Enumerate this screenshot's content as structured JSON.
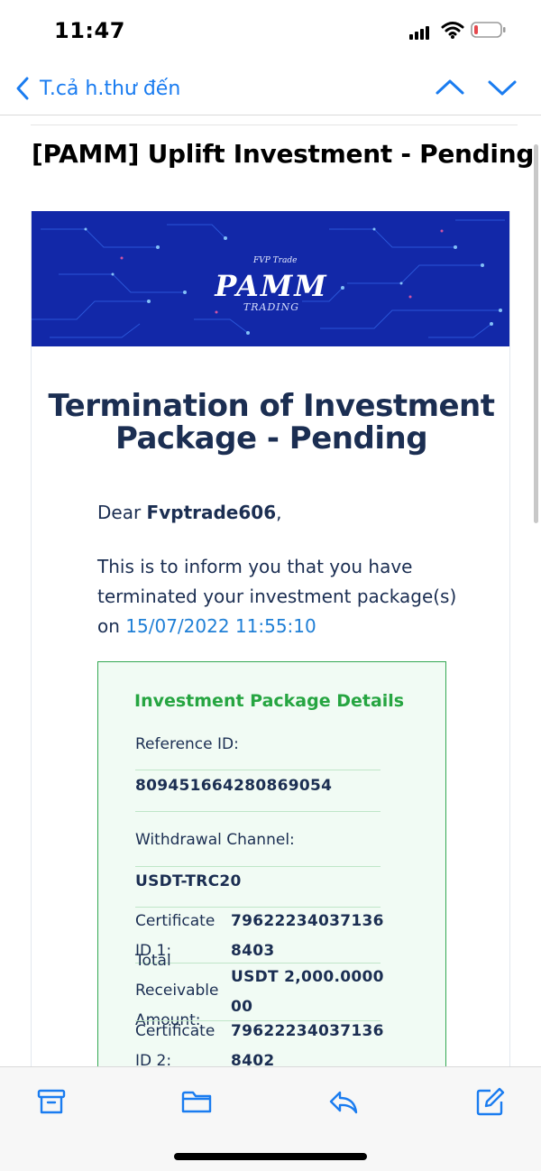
{
  "status_bar": {
    "time": "11:47",
    "icons": [
      "signal-icon",
      "wifi-icon",
      "battery-icon"
    ],
    "battery_color": "#e5484d"
  },
  "nav": {
    "back_label": "T.cả h.thư đến",
    "icons": [
      "chevron-left-icon",
      "chevron-up-icon",
      "chevron-down-icon"
    ],
    "accent": "#1a7cf0"
  },
  "email": {
    "subject": "[PAMM] Uplift Investment - Pending",
    "banner": {
      "brand_small": "FVP Trade",
      "brand_title": "PAMM",
      "brand_sub": "TRADING",
      "background": "#1228a8"
    },
    "heading": "Termination of Investment Package - Pending",
    "greeting_prefix": "Dear ",
    "username": "Fvptrade606",
    "greeting_suffix": ",",
    "intro_text": "This is to inform you that you have terminated your investment package(s) on ",
    "intro_date": "15/07/2022 11:55:10",
    "details": {
      "title": "Investment Package Details",
      "reference_label": "Reference ID:",
      "reference_value": "809451664280869054",
      "channel_label": "Withdrawal Channel:",
      "channel_value": "USDT-TRC20",
      "cert1_label": "Certificate ID 1:",
      "cert1_value": "796222340371368403",
      "total_label": "Total Receivable Amount:",
      "total_value": "USDT 2,000.000000",
      "cert2_label": "Certificate ID 2:",
      "cert2_value": "796222340371368402",
      "border_color": "#34a853",
      "title_color": "#26a541"
    }
  },
  "toolbar": {
    "icons": [
      "archive-icon",
      "folder-icon",
      "reply-icon",
      "compose-icon"
    ],
    "accent": "#1a7cf0"
  }
}
